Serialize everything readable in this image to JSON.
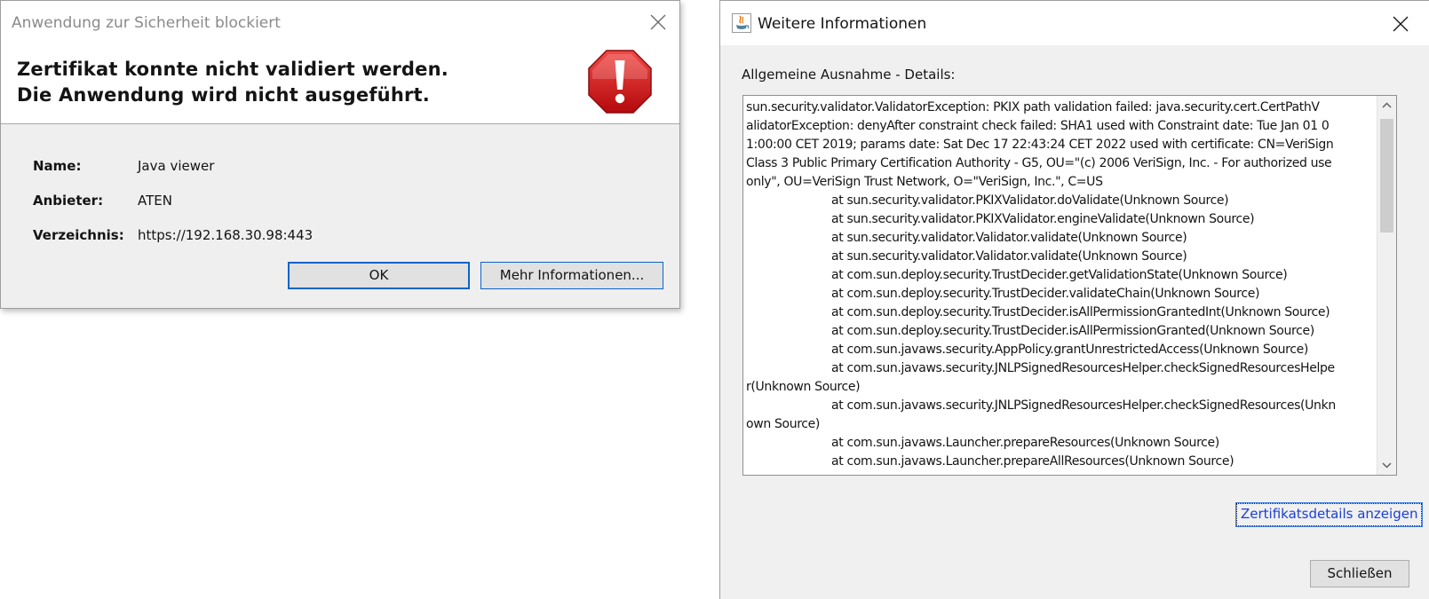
{
  "blocked_dialog": {
    "title": "Anwendung zur Sicherheit blockiert",
    "heading_line1": "Zertifikat konnte nicht validiert werden.",
    "heading_line2": "Die Anwendung wird nicht ausgeführt.",
    "icon": "stop-warning-icon",
    "icon_color": "#d01c1f",
    "fields": {
      "name_label": "Name:",
      "name_value": "Java viewer",
      "vendor_label": "Anbieter:",
      "vendor_value": "ATEN",
      "directory_label": "Verzeichnis:",
      "directory_value": "https://192.168.30.98:443"
    },
    "ok_label": "OK",
    "more_info_label": "Mehr Informationen..."
  },
  "info_dialog": {
    "title": "Weitere Informationen",
    "icon": "java-icon",
    "section_label": "Allgemeine Ausnahme - Details:",
    "stacktrace_lines": [
      "sun.security.validator.ValidatorException: PKIX path validation failed: java.security.cert.CertPathV",
      "alidatorException: denyAfter constraint check failed: SHA1 used with Constraint date: Tue Jan 01 0",
      "1:00:00 CET 2019; params date: Sat Dec 17 22:43:24 CET 2022 used with certificate: CN=VeriSign",
      "Class 3 Public Primary Certification Authority - G5, OU=\"(c) 2006 VeriSign, Inc. - For authorized use",
      "only\", OU=VeriSign Trust Network, O=\"VeriSign, Inc.\", C=US",
      "at sun.security.validator.PKIXValidator.doValidate(Unknown Source)",
      "at sun.security.validator.PKIXValidator.engineValidate(Unknown Source)",
      "at sun.security.validator.Validator.validate(Unknown Source)",
      "at sun.security.validator.Validator.validate(Unknown Source)",
      "at com.sun.deploy.security.TrustDecider.getValidationState(Unknown Source)",
      "at com.sun.deploy.security.TrustDecider.validateChain(Unknown Source)",
      "at com.sun.deploy.security.TrustDecider.isAllPermissionGrantedInt(Unknown Source)",
      "at com.sun.deploy.security.TrustDecider.isAllPermissionGranted(Unknown Source)",
      "at com.sun.javaws.security.AppPolicy.grantUnrestrictedAccess(Unknown Source)",
      "at com.sun.javaws.security.JNLPSignedResourcesHelper.checkSignedResourcesHelpe",
      "r(Unknown Source)",
      "at com.sun.javaws.security.JNLPSignedResourcesHelper.checkSignedResources(Unkn",
      "own Source)",
      "at com.sun.javaws.Launcher.prepareResources(Unknown Source)",
      "at com.sun.javaws.Launcher.prepareAllResources(Unknown Source)"
    ],
    "indented_lines": [
      5,
      6,
      7,
      8,
      9,
      10,
      11,
      12,
      13,
      14,
      16,
      18,
      19
    ],
    "cert_details_link": "Zertifikatsdetails anzeigen",
    "link_color": "#1a3fd8",
    "close_label": "Schließen"
  },
  "colors": {
    "dialog_bg": "#f0f0f0",
    "focus_border": "#0a64c8",
    "button_bg": "#e1e1e1"
  }
}
